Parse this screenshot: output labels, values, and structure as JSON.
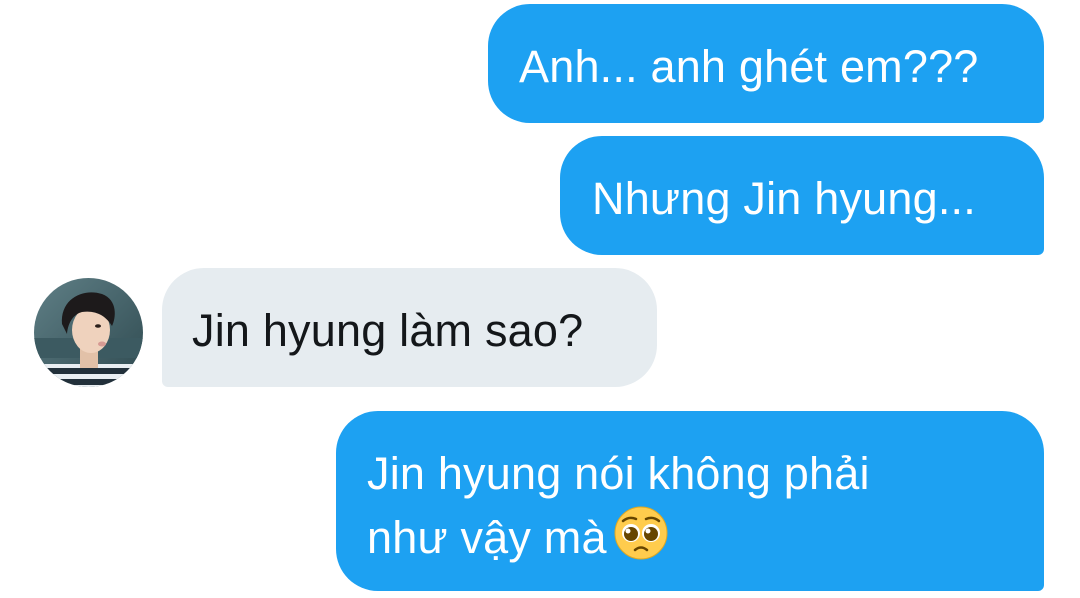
{
  "conversation": {
    "messages": [
      {
        "direction": "outgoing",
        "text": "Anh... anh ghét em???"
      },
      {
        "direction": "outgoing",
        "text": "Nhưng Jin hyung..."
      },
      {
        "direction": "incoming",
        "text": "Jin hyung làm sao?"
      },
      {
        "direction": "outgoing",
        "lines": [
          "Jin hyung nói không phải",
          "như vậy mà"
        ],
        "emoji": "pleading-face-icon"
      }
    ]
  },
  "colors": {
    "outgoing_bubble": "#1da1f2",
    "incoming_bubble": "#e6ecf0",
    "outgoing_text": "#ffffff",
    "incoming_text": "#14171a"
  }
}
